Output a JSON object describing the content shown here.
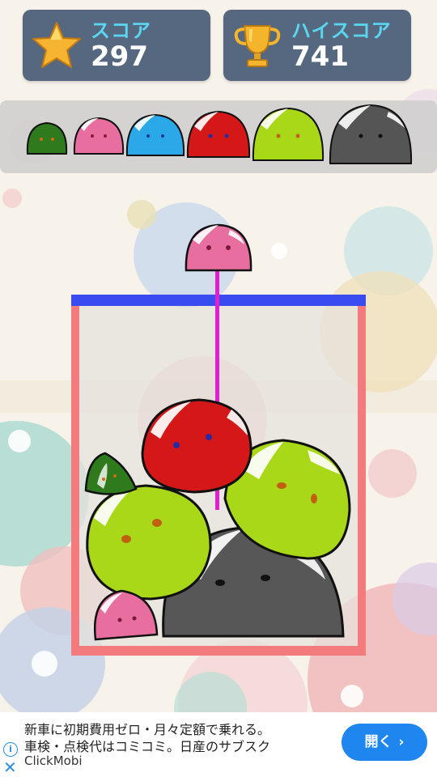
{
  "score": {
    "label": "スコア",
    "value": "297",
    "icon": "star-icon"
  },
  "hiscore": {
    "label": "ハイスコア",
    "value": "741",
    "icon": "trophy-icon"
  },
  "evolution_order": [
    "green",
    "pink",
    "blue",
    "red",
    "lime",
    "gray"
  ],
  "colors": {
    "panel": "#556880",
    "label": "#5ad6f0",
    "container_frame": "#f37b7e",
    "container_top_line": "#3a4cf0",
    "drop_guide": "#e020d0",
    "green": "#2f7a1c",
    "pink": "#e86ea0",
    "blue": "#2aa8e8",
    "red": "#d41818",
    "lime": "#a8d818",
    "gray": "#555555"
  },
  "next_blob": "pink",
  "ad": {
    "line1": "新車に初期費用ゼロ・月々定額で乗れる。",
    "line2": "車検・点検代はコミコミ。日産のサブスク",
    "brand": "ClickMobi",
    "button_label": "開く",
    "info_icon": "info-icon",
    "close_icon": "close-icon"
  }
}
